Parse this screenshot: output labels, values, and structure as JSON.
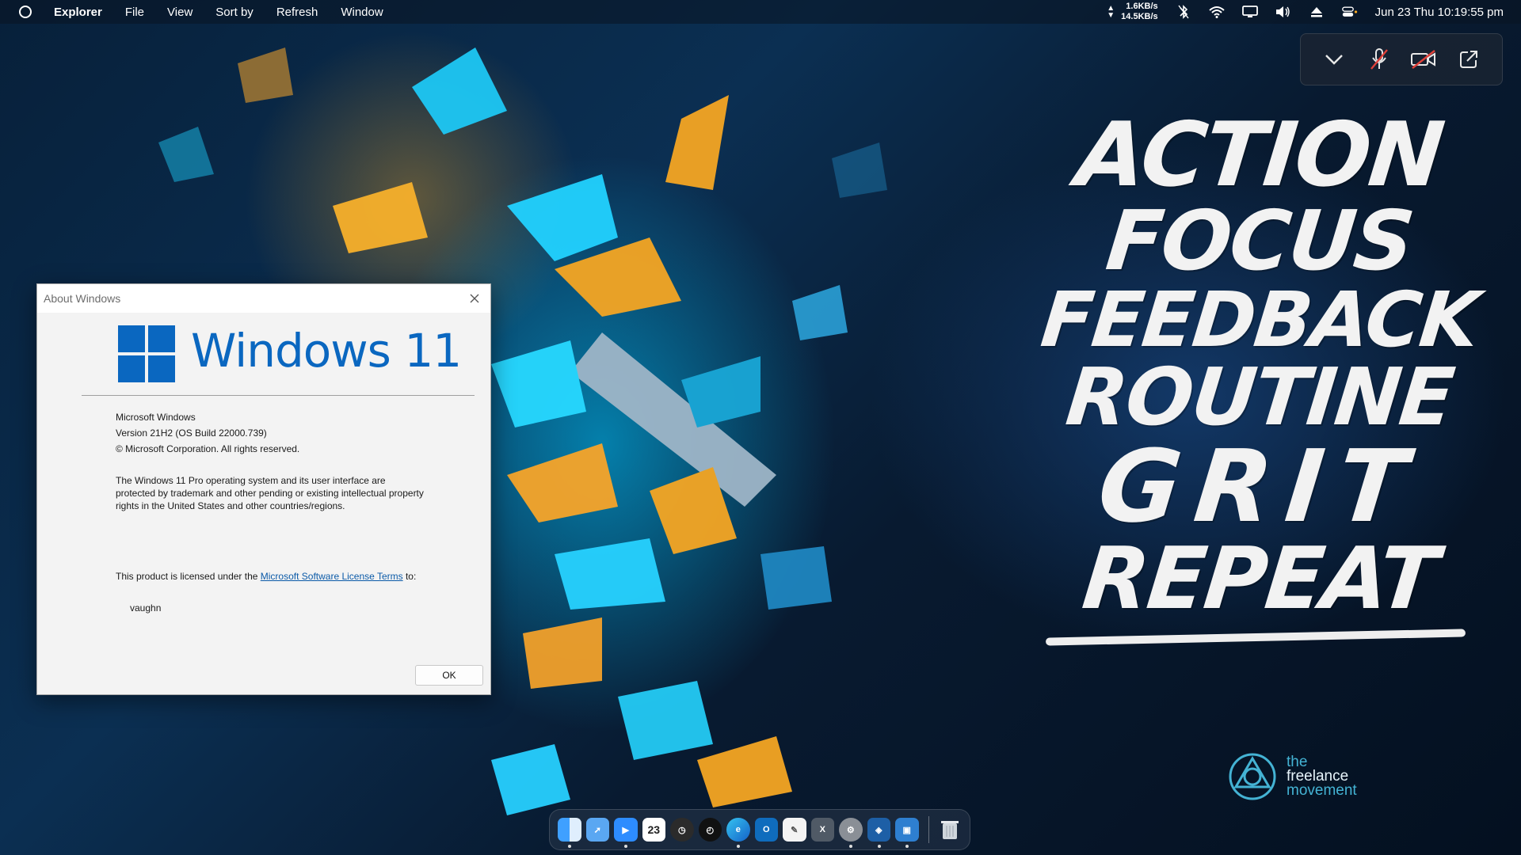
{
  "menubar": {
    "app_name": "Explorer",
    "menus": [
      "File",
      "View",
      "Sort by",
      "Refresh",
      "Window"
    ],
    "net_up": "1.6KB/s",
    "net_down": "14.5KB/s",
    "clock": "Jun 23 Thu 10:19:55 pm",
    "tray_icons": [
      "bluetooth-off-icon",
      "wifi-icon",
      "display-icon",
      "volume-icon",
      "eject-icon",
      "control-center-icon"
    ]
  },
  "meeting_controls": [
    "chevron-down-icon",
    "mic-muted-icon",
    "camera-off-icon",
    "share-screen-icon"
  ],
  "wallpaper": {
    "words": [
      "ACTION",
      "FOCUS",
      "FEEDBACK",
      "ROUTINE",
      "GRIT",
      "REPEAT"
    ],
    "brand_lines": [
      "the",
      "freelance",
      "movement"
    ]
  },
  "dialog": {
    "title": "About Windows",
    "product_name": "Windows 11",
    "line1": "Microsoft Windows",
    "line2": "Version 21H2 (OS Build 22000.739)",
    "line3": "© Microsoft Corporation. All rights reserved.",
    "paragraph": "The Windows 11 Pro operating system and its user interface are protected by trademark and other pending or existing intellectual property rights in the United States and other countries/regions.",
    "license_prefix": "This product is licensed under the ",
    "license_link": "Microsoft Software License Terms",
    "license_suffix": " to:",
    "user": "vaughn",
    "ok_label": "OK"
  },
  "dock": {
    "apps": [
      "finder-icon",
      "launchpad-icon",
      "zoom-icon",
      "calendar-icon",
      "time-machine-icon",
      "clock-icon",
      "edge-icon",
      "outlook-icon",
      "notes-icon",
      "excel-icon",
      "settings-icon",
      "sketchup-icon",
      "preview-icon"
    ],
    "calendar_day": "23",
    "trash": "trash-icon"
  },
  "colors": {
    "windows_blue": "#0a67c0",
    "brand_teal": "#44b3d4",
    "link_blue": "#0b5aa8"
  }
}
